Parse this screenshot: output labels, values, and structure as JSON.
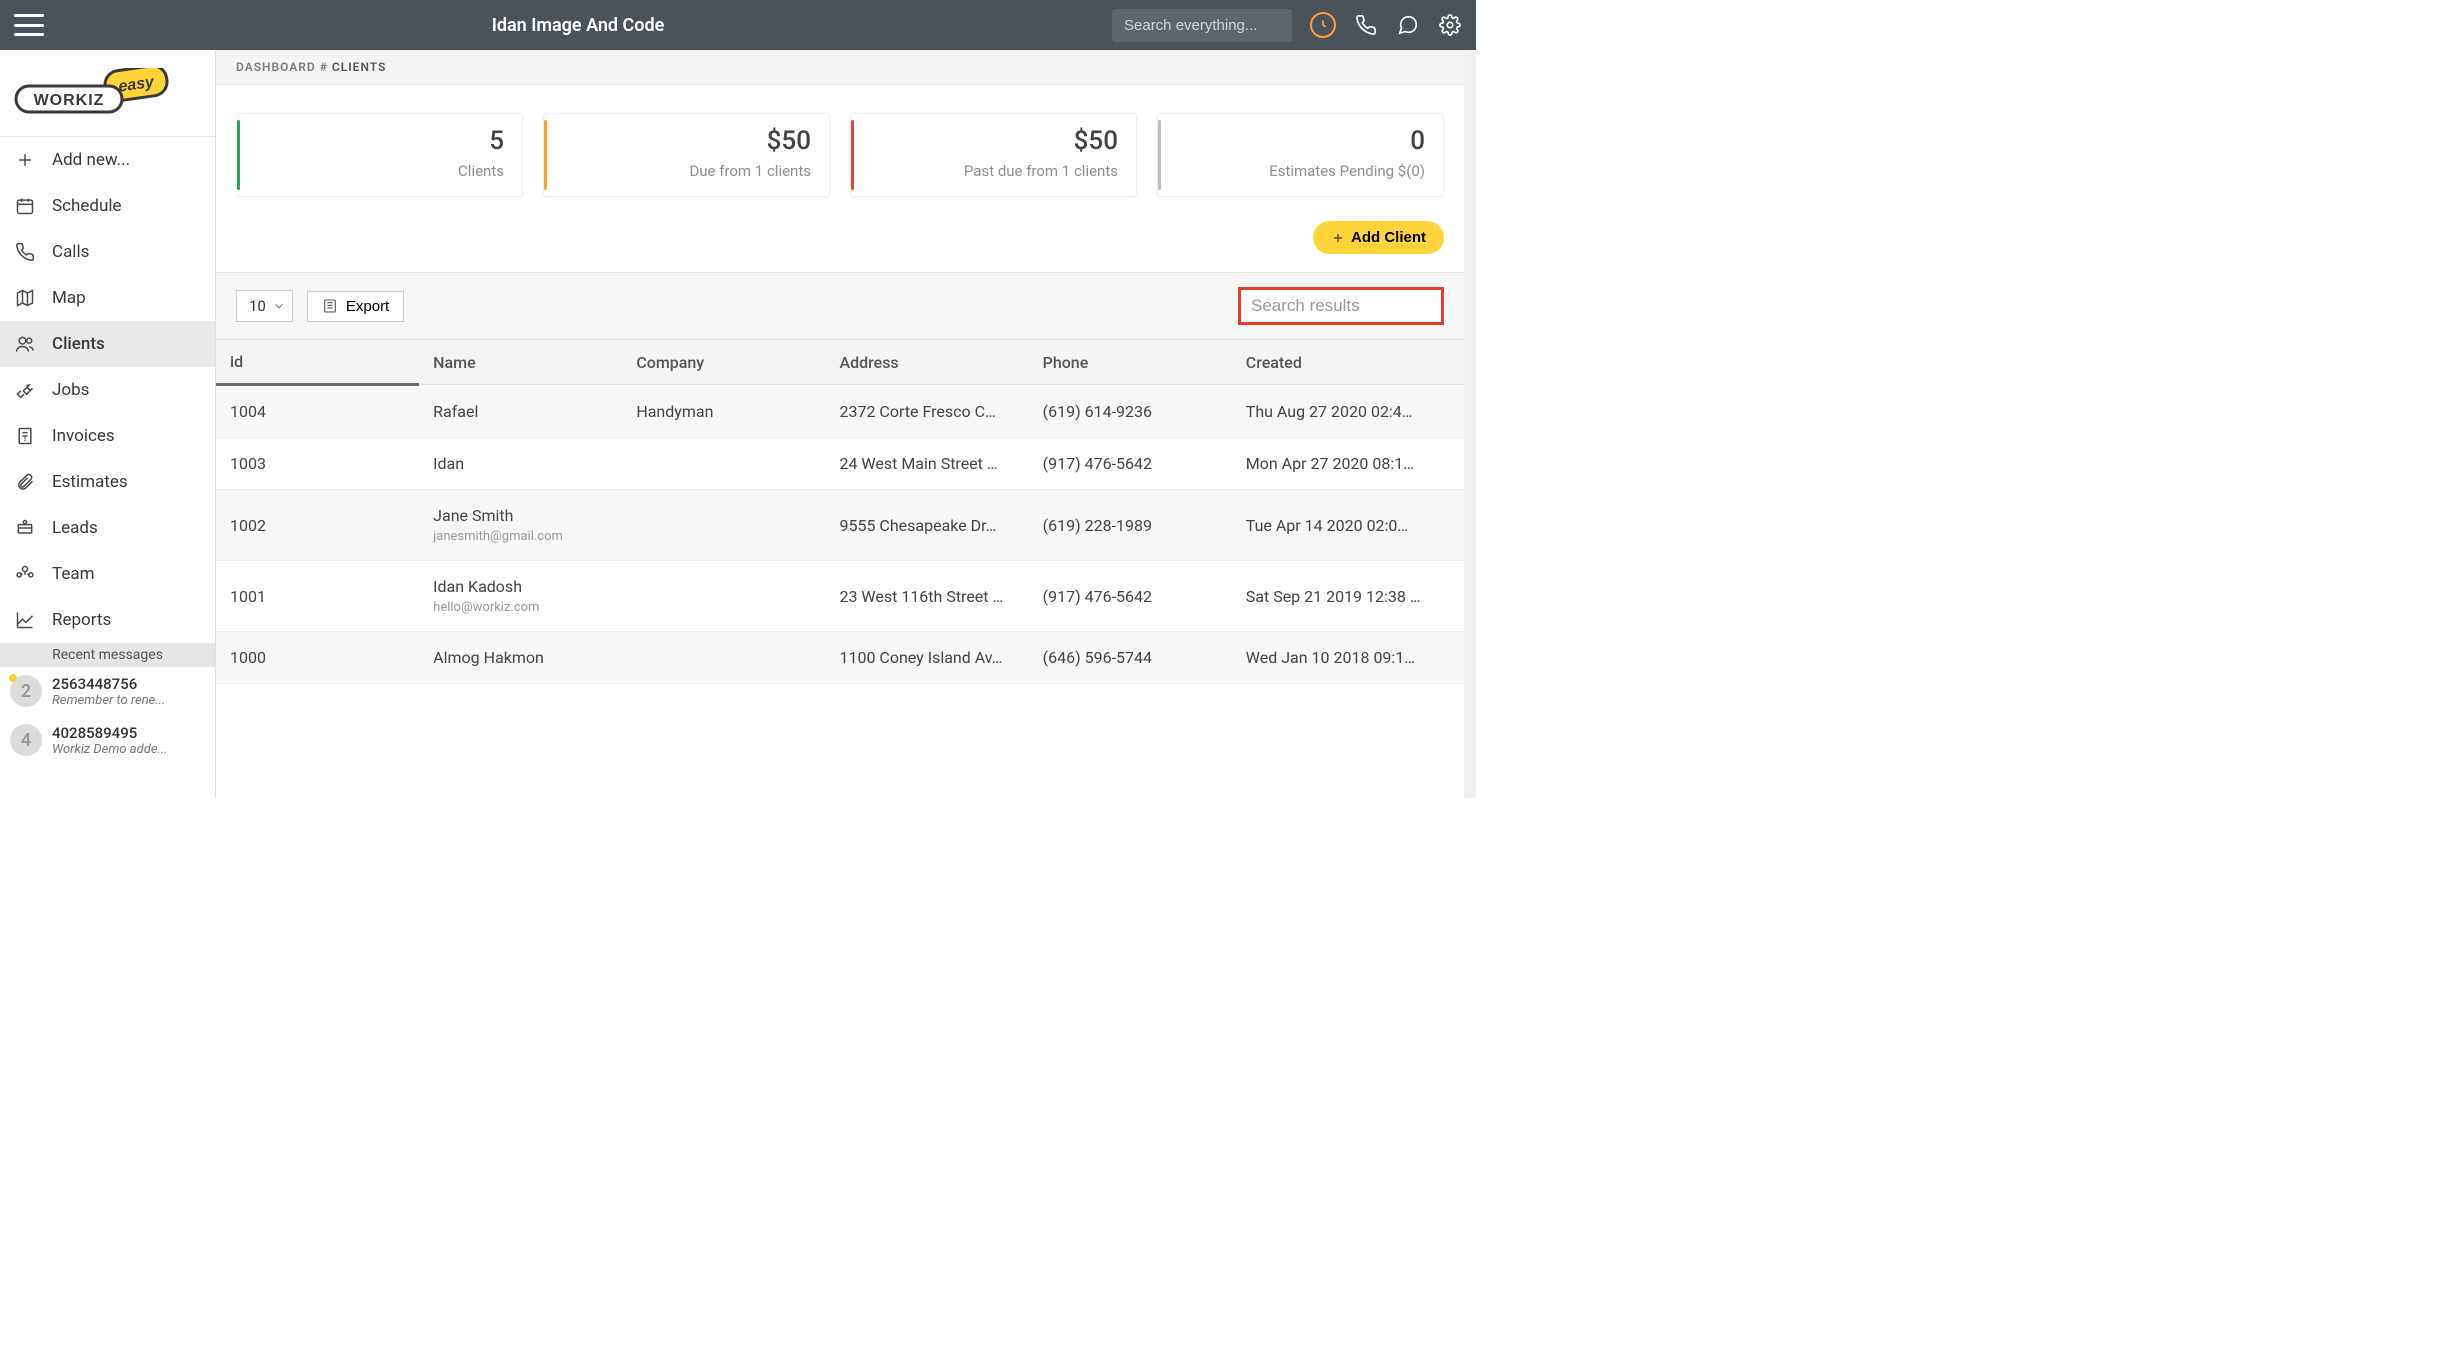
{
  "header": {
    "title": "Idan Image And Code",
    "search_placeholder": "Search everything..."
  },
  "logo": {
    "brand_left": "WORKIZ",
    "brand_right": "easy"
  },
  "sidebar": {
    "items": [
      {
        "label": "Add new...",
        "icon": "plus-icon"
      },
      {
        "label": "Schedule",
        "icon": "calendar-icon"
      },
      {
        "label": "Calls",
        "icon": "phone-icon"
      },
      {
        "label": "Map",
        "icon": "map-icon"
      },
      {
        "label": "Clients",
        "icon": "users-icon"
      },
      {
        "label": "Jobs",
        "icon": "tools-icon"
      },
      {
        "label": "Invoices",
        "icon": "invoice-icon"
      },
      {
        "label": "Estimates",
        "icon": "attach-icon"
      },
      {
        "label": "Leads",
        "icon": "leads-icon"
      },
      {
        "label": "Team",
        "icon": "team-icon"
      },
      {
        "label": "Reports",
        "icon": "reports-icon"
      }
    ],
    "active_index": 4,
    "recent_title": "Recent messages",
    "recent": [
      {
        "badge": "2",
        "number": "2563448756",
        "preview": "Remember to rene..."
      },
      {
        "badge": "4",
        "number": "4028589495",
        "preview": "Workiz Demo adde..."
      }
    ]
  },
  "breadcrumb": {
    "root": "DASHBOARD",
    "separator": "#",
    "current": "CLIENTS"
  },
  "stats": [
    {
      "value": "5",
      "label": "Clients",
      "tone": "green"
    },
    {
      "value": "$50",
      "label": "Due from 1 clients",
      "tone": "yellow"
    },
    {
      "value": "$50",
      "label": "Past due from 1 clients",
      "tone": "red"
    },
    {
      "value": "0",
      "label": "Estimates Pending $(0)",
      "tone": "gray"
    }
  ],
  "buttons": {
    "add_client": "Add Client",
    "export": "Export"
  },
  "table": {
    "page_size": "10",
    "search_placeholder": "Search results",
    "columns": [
      "id",
      "Name",
      "Company",
      "Address",
      "Phone",
      "Created"
    ],
    "rows": [
      {
        "id": "1004",
        "name": "Rafael",
        "email": "",
        "company": "Handyman",
        "address": "2372 Corte Fresco C…",
        "phone": "(619) 614-9236",
        "created": "Thu Aug 27 2020 02:4…"
      },
      {
        "id": "1003",
        "name": "Idan",
        "email": "",
        "company": "",
        "address": "24 West Main Street …",
        "phone": "(917) 476-5642",
        "created": "Mon Apr 27 2020 08:1…"
      },
      {
        "id": "1002",
        "name": "Jane Smith",
        "email": "janesmith@gmail.com",
        "company": "",
        "address": "9555 Chesapeake Dr…",
        "phone": "(619) 228-1989",
        "created": "Tue Apr 14 2020 02:0…"
      },
      {
        "id": "1001",
        "name": "Idan Kadosh",
        "email": "hello@workiz.com",
        "company": "",
        "address": "23 West 116th Street …",
        "phone": "(917) 476-5642",
        "created": "Sat Sep 21 2019 12:38 …"
      },
      {
        "id": "1000",
        "name": "Almog Hakmon",
        "email": "",
        "company": "",
        "address": "1100 Coney Island Av…",
        "phone": "(646) 596-5744",
        "created": "Wed Jan 10 2018 09:1…"
      }
    ]
  }
}
